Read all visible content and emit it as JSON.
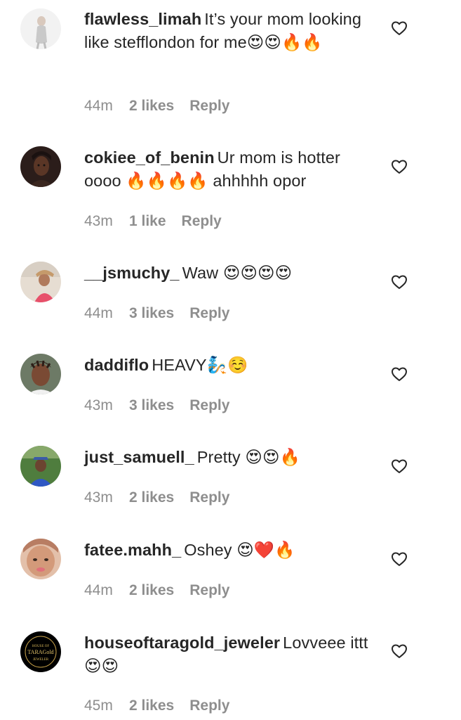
{
  "comments": [
    {
      "username": "flawless_limah",
      "text": "It’s your mom looking like stefflondon for me😍😍🔥🔥",
      "time": "44m",
      "likes": "2 likes",
      "reply": "Reply"
    },
    {
      "username": "cokiee_of_benin",
      "text": "Ur mom is hotter oooo 🔥🔥🔥🔥 ahhhhh opor",
      "time": "43m",
      "likes": "1 like",
      "reply": "Reply"
    },
    {
      "username": "__jsmuchy_",
      "text": "Waw 😍😍😍😍",
      "time": "44m",
      "likes": "3 likes",
      "reply": "Reply"
    },
    {
      "username": "daddiflo",
      "text": "HEAVY🧞☺️",
      "time": "43m",
      "likes": "3 likes",
      "reply": "Reply"
    },
    {
      "username": "just_samuell_",
      "text": "Pretty 😍😍🔥",
      "time": "43m",
      "likes": "2 likes",
      "reply": "Reply"
    },
    {
      "username": "fatee.mahh_",
      "text": "Oshey 😍❤️🔥",
      "time": "44m",
      "likes": "2 likes",
      "reply": "Reply"
    },
    {
      "username": "houseoftaragold_jeweler",
      "text": "Lovveee ittt😍😍",
      "time": "45m",
      "likes": "2 likes",
      "reply": "Reply",
      "avatar_logo_text": "HOUSE OF TARAGold JEWELER"
    }
  ],
  "icons": {
    "like": "heart-outline-icon"
  },
  "colors": {
    "text": "#262626",
    "meta": "#8e8e8e",
    "background": "#ffffff"
  }
}
